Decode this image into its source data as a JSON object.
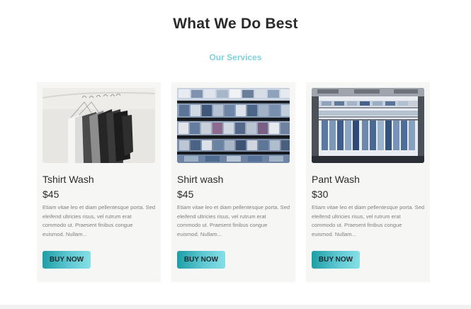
{
  "section": {
    "title": "What We Do Best",
    "subtitle": "Our Services"
  },
  "colors": {
    "accent": "#7fd0dc",
    "button_gradient_start": "#1f9ea6",
    "button_gradient_end": "#86dfe6",
    "card_background": "#f6f6f4"
  },
  "services": [
    {
      "title": "Tshirt Wash",
      "price": "$45",
      "description": "Etiam vitae leo et diam pellentesque porta. Sed eleifend ultricies risus, vel rutrum erat commodo ut. Praesent finibus congue euismod. Nullam...",
      "button_label": "BUY NOW",
      "image": "tshirts-on-hangers-photo"
    },
    {
      "title": "Shirt wash",
      "price": "$45",
      "description": "Etiam vitae leo et diam pellentesque porta. Sed eleifend ultricies risus, vel rutrum erat commodo ut. Praesent finibus congue euismod. Nullam...",
      "button_label": "BUY NOW",
      "image": "folded-shirts-on-shelves-photo"
    },
    {
      "title": "Pant Wash",
      "price": "$30",
      "description": "Etiam vitae leo et diam pellentesque porta. Sed eleifend ultricies risus, vel rutrum erat commodo ut. Praesent finibus congue euismod. Nullam...",
      "button_label": "BUY NOW",
      "image": "jeans-display-rack-photo"
    }
  ]
}
